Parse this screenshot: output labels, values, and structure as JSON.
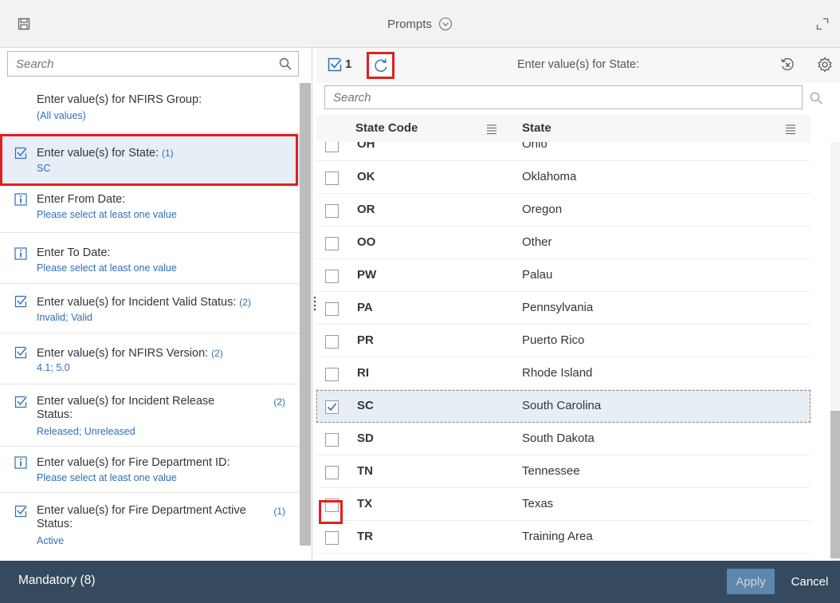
{
  "header": {
    "title": "Prompts"
  },
  "left_panel": {
    "search_placeholder": "Search",
    "prompts": [
      {
        "title": "Enter value(s) for NFIRS Group:",
        "count": "",
        "value": "(All values)",
        "icon": "none",
        "selected": false
      },
      {
        "title": "Enter value(s) for State:",
        "count": "(1)",
        "value": "SC",
        "icon": "check-icon",
        "selected": true
      },
      {
        "title": "Enter From Date:",
        "count": "",
        "value": "Please select at least one value",
        "icon": "info-icon",
        "selected": false
      },
      {
        "title": "Enter To Date:",
        "count": "",
        "value": "Please select at least one value",
        "icon": "info-icon",
        "selected": false
      },
      {
        "title": "Enter value(s) for Incident Valid Status:",
        "count": "(2)",
        "value": "Invalid; Valid",
        "icon": "check-icon",
        "selected": false
      },
      {
        "title": "Enter value(s) for NFIRS Version:",
        "count": "(2)",
        "value": "4.1; 5.0",
        "icon": "check-icon",
        "selected": false
      },
      {
        "title": "Enter value(s) for Incident Release Status:",
        "count": "(2)",
        "value": "Released; Unreleased",
        "icon": "check-icon",
        "selected": false
      },
      {
        "title": "Enter value(s) for Fire Department ID:",
        "count": "",
        "value": "Please select at least one value",
        "icon": "info-icon",
        "selected": false
      },
      {
        "title": "Enter value(s) for Fire Department Active Status:",
        "count": "(1)",
        "value": "Active",
        "icon": "check-icon",
        "selected": false
      }
    ]
  },
  "right_panel": {
    "selected_count": "1",
    "title": "Enter value(s) for State:",
    "search_placeholder": "Search",
    "columns": [
      "State Code",
      "State"
    ],
    "rows": [
      {
        "code": "OH",
        "name": "Ohio",
        "checked": false
      },
      {
        "code": "OK",
        "name": "Oklahoma",
        "checked": false
      },
      {
        "code": "OR",
        "name": "Oregon",
        "checked": false
      },
      {
        "code": "OO",
        "name": "Other",
        "checked": false
      },
      {
        "code": "PW",
        "name": "Palau",
        "checked": false
      },
      {
        "code": "PA",
        "name": "Pennsylvania",
        "checked": false
      },
      {
        "code": "PR",
        "name": "Puerto Rico",
        "checked": false
      },
      {
        "code": "RI",
        "name": "Rhode Island",
        "checked": false
      },
      {
        "code": "SC",
        "name": "South Carolina",
        "checked": true
      },
      {
        "code": "SD",
        "name": "South Dakota",
        "checked": false
      },
      {
        "code": "TN",
        "name": "Tennessee",
        "checked": false
      },
      {
        "code": "TX",
        "name": "Texas",
        "checked": false
      },
      {
        "code": "TR",
        "name": "Training Area",
        "checked": false
      }
    ]
  },
  "footer": {
    "mandatory_label": "Mandatory (8)",
    "apply_label": "Apply",
    "cancel_label": "Cancel"
  },
  "colors": {
    "accent": "#2f6fb5",
    "footer_bg": "#354a5f",
    "highlight": "#e02020",
    "selected_bg": "#e7eef6"
  }
}
